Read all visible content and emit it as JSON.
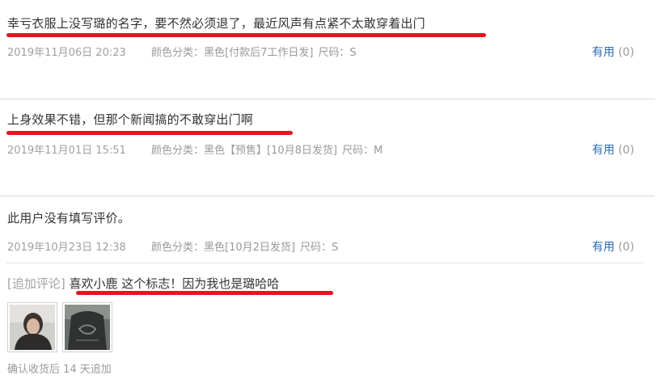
{
  "reviews": [
    {
      "text": "幸亏衣服上没写璐的名字，要不然必须退了，最近风声有点紧不太敢穿着出门",
      "date": "2019年11月06日 20:23",
      "color": "颜色分类：黑色[付款后7工作日发]",
      "size": "尺码：S",
      "useful_label": "有用",
      "useful_count": "(0)"
    },
    {
      "text": "上身效果不错，但那个新闻搞的不敢穿出门啊",
      "date": "2019年11月01日 15:51",
      "color": "颜色分类：黑色【预售】[10月8日发货]",
      "size": "尺码：M",
      "useful_label": "有用",
      "useful_count": "(0)"
    },
    {
      "text": "此用户没有填写评价。",
      "date": "2019年10月23日 12:38",
      "color": "颜色分类：黑色[10月2日发货]",
      "size": "尺码：S",
      "useful_label": "有用",
      "useful_count": "(0)",
      "append": {
        "tag": "[追加评论]",
        "text": "喜欢小鹿 这个标志！因为我也是璐哈哈",
        "note": "确认收货后 14 天追加"
      }
    }
  ],
  "colors": {
    "underline": "#e4151f",
    "link": "#2a6ab0",
    "muted": "#999999",
    "text": "#333333"
  }
}
